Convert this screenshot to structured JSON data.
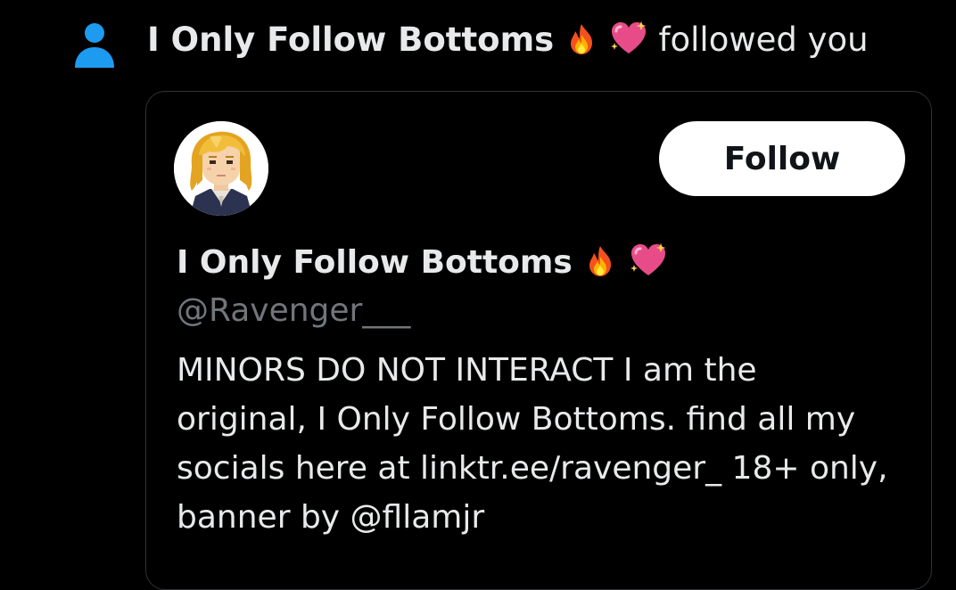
{
  "notification": {
    "actor_name": "I Only Follow Bottoms",
    "actor_emojis": "🔥💖",
    "action_text": "followed you",
    "icon": "person-icon"
  },
  "card": {
    "display_name": "I Only Follow Bottoms",
    "display_emojis": "🔥💖",
    "handle": "@Ravenger___",
    "follow_label": "Follow",
    "bio_lines": [
      "MINORS DO NOT INTERACT I am the",
      "original, I Only Follow Bottoms. find all my",
      "socials here at linktr.ee/ravenger_ 18+ only,",
      "banner by @fllamjr"
    ],
    "avatar": "pixel-art-avatar"
  },
  "colors": {
    "background": "#000000",
    "text_primary": "#e7e9ea",
    "text_secondary": "#71767b",
    "accent": "#1d9bf0",
    "border": "#2f3336",
    "button_bg": "#ffffff",
    "button_text": "#0f1419"
  }
}
